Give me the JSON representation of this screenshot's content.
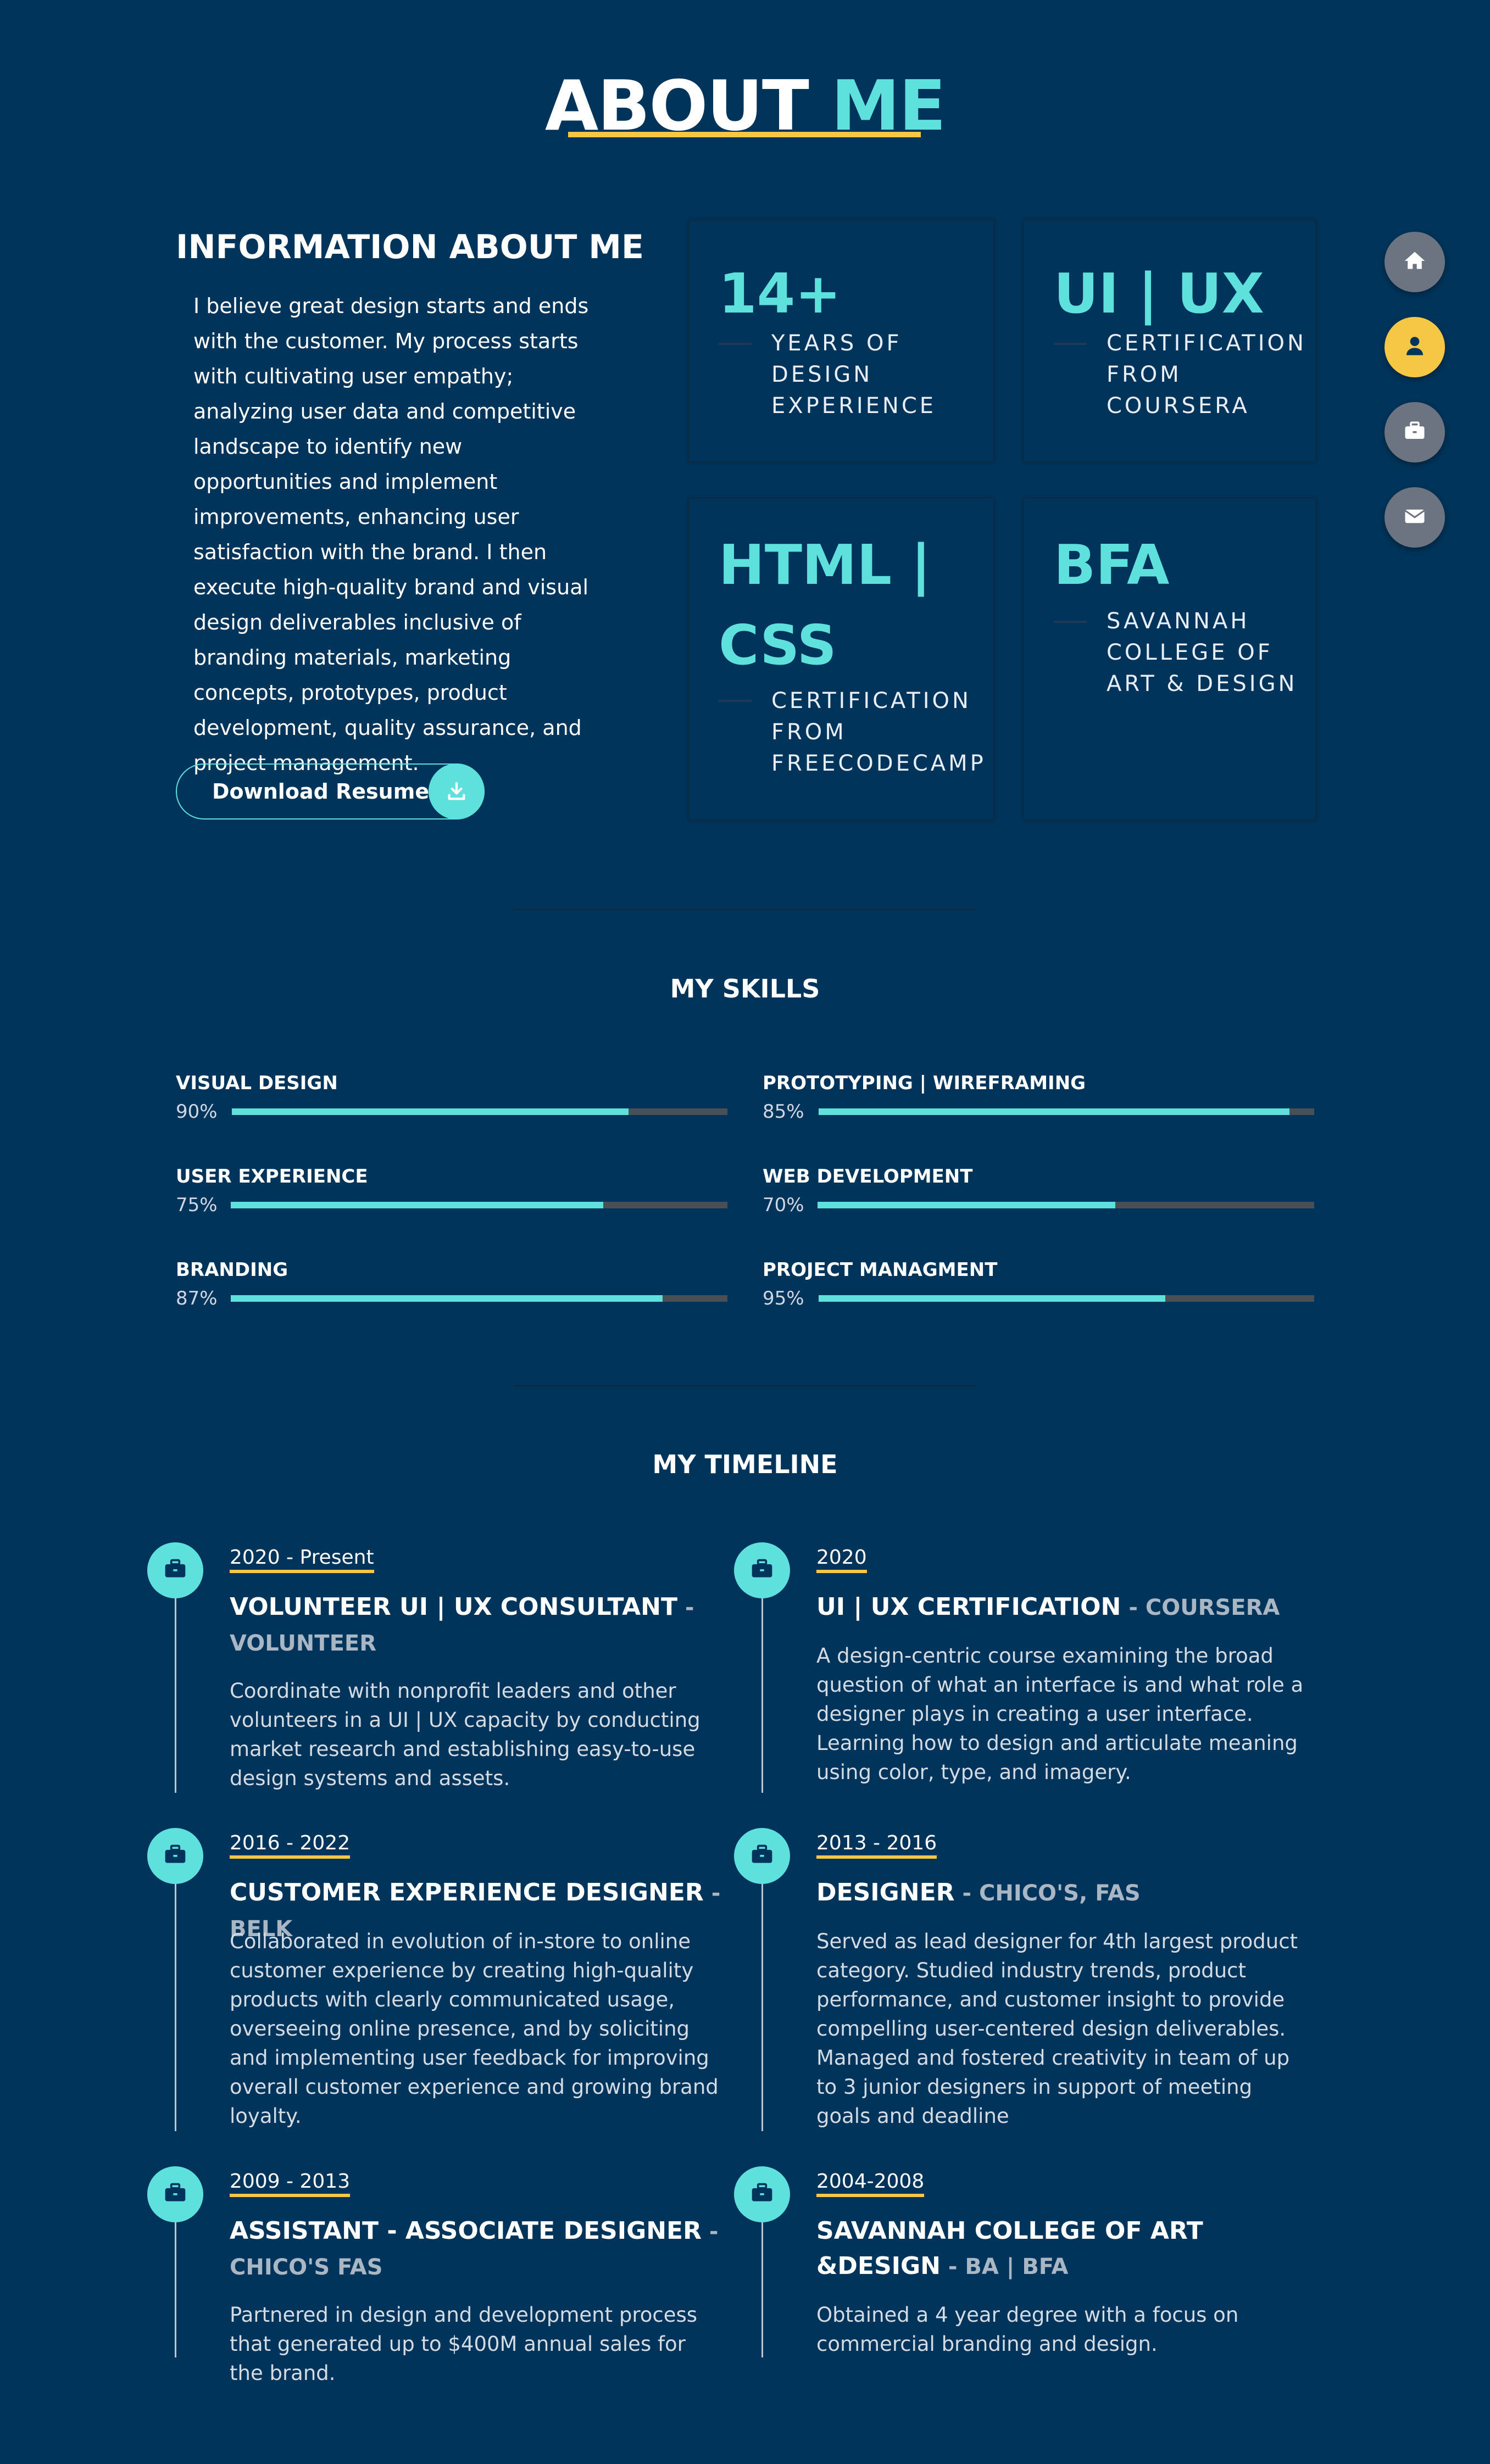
{
  "header": {
    "title_white": "ABOUT",
    "title_accent": "ME"
  },
  "info": {
    "heading": "INFORMATION ABOUT ME",
    "paragraph": "I believe great design starts and ends with the customer. My process starts with cultivating user empathy; analyzing user data and competitive landscape to identify new opportunities and implement improvements, enhancing user satisfaction with the brand. I then execute high-quality brand and visual design deliverables inclusive of branding materials, marketing concepts, prototypes, product development, quality assurance, and project management.",
    "download_label": "Download Resume"
  },
  "cards": [
    {
      "big": "14+",
      "sub": "YEARS OF DESIGN EXPERIENCE"
    },
    {
      "big": "UI | UX",
      "sub": "CERTIFICATION FROM COURSERA"
    },
    {
      "big": "HTML | CSS",
      "sub": "CERTIFICATION FROM FREECODECAMP"
    },
    {
      "big": "BFA",
      "sub": "SAVANNAH COLLEGE OF ART & DESIGN"
    }
  ],
  "nav": [
    {
      "icon": "home-icon",
      "active": false
    },
    {
      "icon": "user-icon",
      "active": true
    },
    {
      "icon": "briefcase-icon",
      "active": false
    },
    {
      "icon": "envelope-icon",
      "active": false
    }
  ],
  "skills": {
    "title": "MY SKILLS",
    "items": [
      {
        "name": "VISUAL DESIGN",
        "pct": "90%",
        "value": 0.8
      },
      {
        "name": "PROTOTYPING | WIREFRAMING",
        "pct": "85%",
        "value": 0.95
      },
      {
        "name": "USER EXPERIENCE",
        "pct": "75%",
        "value": 0.75
      },
      {
        "name": "WEB DEVELOPMENT",
        "pct": "70%",
        "value": 0.6
      },
      {
        "name": "BRANDING",
        "pct": "87%",
        "value": 0.87
      },
      {
        "name": "PROJECT MANAGMENT",
        "pct": "95%",
        "value": 0.7
      }
    ]
  },
  "timeline": {
    "title": "MY TIMELINE",
    "items": [
      {
        "date": "2020 - Present",
        "title": "VOLUNTEER UI | UX CONSULTANT",
        "org": " - VOLUNTEER",
        "desc": "Coordinate with nonprofit leaders and other volunteers in a UI | UX capacity by conducting market research and establishing easy-to-use design systems and assets."
      },
      {
        "date": "2020",
        "title": "UI | UX CERTIFICATION",
        "org": " - COURSERA",
        "desc": "A design-centric course examining the broad question of what an interface is and what role a designer plays in creating a user interface. Learning how to design and articulate meaning using color, type, and imagery."
      },
      {
        "date": "2016 - 2022",
        "title": "CUSTOMER EXPERIENCE DESIGNER",
        "org": " - BELK",
        "desc": "Collaborated in evolution of in-store to online customer experience by creating high-quality products with clearly communicated usage, overseeing online presence, and by soliciting and implementing user feedback for improving overall customer experience and growing brand loyalty."
      },
      {
        "date": "2013 - 2016",
        "title": "DESIGNER",
        "org": " - CHICO'S, FAS",
        "desc": "Served as lead designer for 4th largest product category. Studied industry trends, product performance, and customer insight to provide compelling user-centered design deliverables. Managed and fostered creativity in team of up to 3 junior designers in support of meeting goals and deadline"
      },
      {
        "date": "2009 - 2013",
        "title": "ASSISTANT - ASSOCIATE DESIGNER",
        "org": " - CHICO'S FAS",
        "desc": "Partnered in design and development process that generated up to $400M annual sales for the brand."
      },
      {
        "date": "2004-2008",
        "title": "SAVANNAH COLLEGE OF ART &DESIGN",
        "org": " - BA | BFA",
        "desc": "Obtained a 4 year degree with a focus on commercial branding and design."
      }
    ]
  },
  "colors": {
    "background": "#00345a",
    "accent": "#5ee0dc",
    "highlight": "#f6c744"
  }
}
